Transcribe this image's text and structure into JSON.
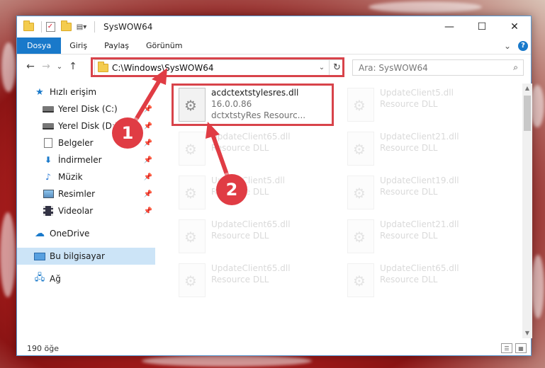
{
  "window": {
    "title": "SysWOW64",
    "minimize": "—",
    "maximize": "☐",
    "close": "✕"
  },
  "ribbon": {
    "tabs": [
      "Dosya",
      "Giriş",
      "Paylaş",
      "Görünüm"
    ],
    "expand": "⌄",
    "help": "?"
  },
  "nav": {
    "back": "←",
    "forward": "→",
    "recent": "⌄",
    "up": "↑",
    "address": "C:\\Windows\\SysWOW64",
    "address_dropdown": "⌄",
    "refresh": "↻",
    "search_placeholder": "Ara: SysWOW64",
    "search_icon": "⌕"
  },
  "sidebar": {
    "items": [
      {
        "label": "Hızlı erişim",
        "icon": "star-icon",
        "pinned": false
      },
      {
        "label": "Yerel Disk (C:)",
        "icon": "disk-icon",
        "pinned": true
      },
      {
        "label": "Yerel Disk (D:)",
        "icon": "disk-icon",
        "pinned": true
      },
      {
        "label": "Belgeler",
        "icon": "document-icon",
        "pinned": true
      },
      {
        "label": "İndirmeler",
        "icon": "download-icon",
        "pinned": true
      },
      {
        "label": "Müzik",
        "icon": "music-icon",
        "pinned": true
      },
      {
        "label": "Resimler",
        "icon": "pictures-icon",
        "pinned": true
      },
      {
        "label": "Videolar",
        "icon": "video-icon",
        "pinned": true
      },
      {
        "label": "OneDrive",
        "icon": "cloud-icon",
        "pinned": false
      },
      {
        "label": "Bu bilgisayar",
        "icon": "computer-icon",
        "pinned": false
      },
      {
        "label": "Ağ",
        "icon": "network-icon",
        "pinned": false
      }
    ],
    "pin_glyph": "📌"
  },
  "files": {
    "main": {
      "name": "acdctextstylesres.dll",
      "version": "16.0.0.86",
      "description": "dctxtstyRes Resourc..."
    },
    "ghosts": [
      {
        "name": "UpdateClient5.dll",
        "description": "Resource DLL"
      },
      {
        "name": "UpdateClient65.dll",
        "description": "Resource DLL"
      },
      {
        "name": "UpdateClient21.dll",
        "description": "Resource DLL"
      },
      {
        "name": "UpdateClient5.dll",
        "description": "Resource DLL"
      },
      {
        "name": "UpdateClient19.dll",
        "description": "Resource DLL"
      },
      {
        "name": "UpdateClient65.dll",
        "description": "Resource DLL"
      },
      {
        "name": "UpdateClient21.dll",
        "description": "Resource DLL"
      },
      {
        "name": "UpdateClient65.dll",
        "description": "Resource DLL"
      },
      {
        "name": "UpdateClient65.dll",
        "description": "Resource DLL"
      }
    ]
  },
  "status": {
    "count": "190 öğe"
  },
  "annotations": {
    "badge1": "1",
    "badge2": "2",
    "highlight_color": "#d8434a"
  }
}
